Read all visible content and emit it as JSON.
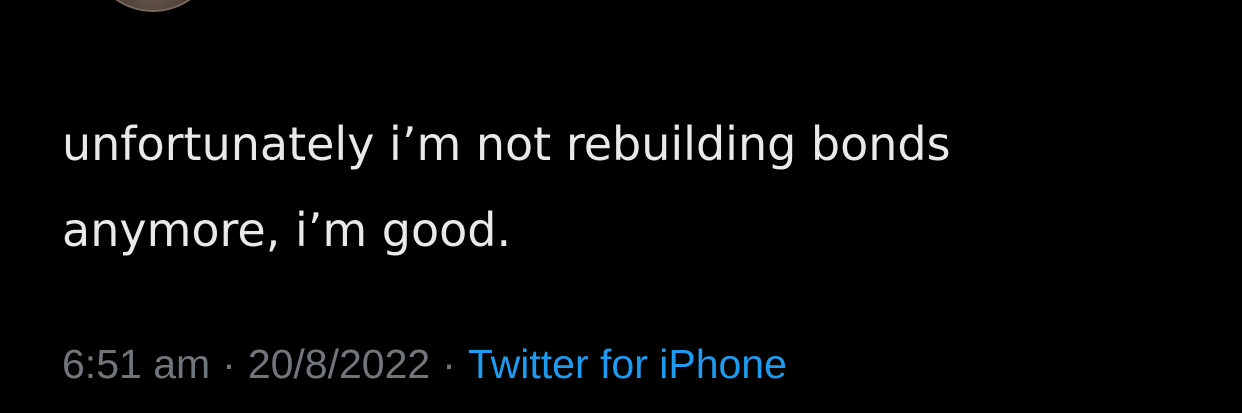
{
  "tweet": {
    "text": "unfortunately i’m not rebuilding bonds\nanymore, i’m good.",
    "time": "6:51 am",
    "separator": "·",
    "date": "20/8/2022",
    "source": "Twitter for iPhone"
  },
  "colors": {
    "background": "#000000",
    "text": "#e7e9ea",
    "meta": "#71767b",
    "link": "#1d9bf0"
  }
}
